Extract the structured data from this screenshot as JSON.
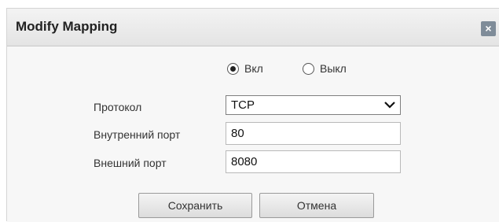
{
  "dialog": {
    "title": "Modify Mapping",
    "close_label": "×"
  },
  "status": {
    "on_label": "Вкл",
    "off_label": "Выкл",
    "selected": "on"
  },
  "protocol": {
    "label": "Протокол",
    "value": "TCP"
  },
  "internal_port": {
    "label": "Внутренний порт",
    "value": "80"
  },
  "external_port": {
    "label": "Внешний порт",
    "value": "8080"
  },
  "buttons": {
    "save_label": "Сохранить",
    "cancel_label": "Отмена"
  },
  "icons": {
    "close": "close-icon",
    "dropdown": "chevron-down-icon"
  }
}
